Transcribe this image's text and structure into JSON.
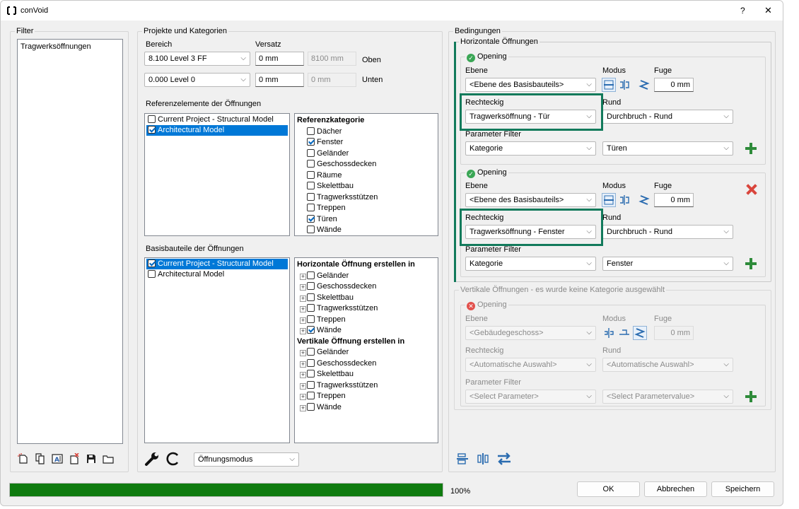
{
  "window": {
    "app_icon": "bracket-logo-icon",
    "title": "conVoid",
    "help_label": "?",
    "close_label": "✕"
  },
  "filter": {
    "label": "Filter",
    "items": [
      "Tragwerksöffnungen"
    ],
    "toolbar_icons": [
      "new-filter-icon",
      "copy-filter-icon",
      "rename-filter-icon",
      "delete-filter-icon",
      "save-filter-icon",
      "open-folder-icon"
    ]
  },
  "projects": {
    "label": "Projekte und Kategorien",
    "bereich_label": "Bereich",
    "versatz_label": "Versatz",
    "level_top": "8.100  Level 3 FF",
    "offset_top": "0 mm",
    "value_top": "8100 mm",
    "oben_label": "Oben",
    "level_bottom": "0.000  Level 0",
    "offset_bottom": "0 mm",
    "value_bottom": "0 mm",
    "unten_label": "Unten",
    "ref_label": "Referenzelemente der Öffnungen",
    "ref_models": [
      {
        "label": "Current Project - Structural Model",
        "checked": false,
        "selected": false
      },
      {
        "label": "Architectural Model",
        "checked": true,
        "selected": true
      }
    ],
    "ref_category_header": "Referenzkategorie",
    "ref_categories": [
      {
        "label": "Dächer",
        "checked": false
      },
      {
        "label": "Fenster",
        "checked": true
      },
      {
        "label": "Geländer",
        "checked": false
      },
      {
        "label": "Geschossdecken",
        "checked": false
      },
      {
        "label": "Räume",
        "checked": false
      },
      {
        "label": "Skelettbau",
        "checked": false
      },
      {
        "label": "Tragwerksstützen",
        "checked": false
      },
      {
        "label": "Treppen",
        "checked": false
      },
      {
        "label": "Türen",
        "checked": true
      },
      {
        "label": "Wände",
        "checked": false
      }
    ],
    "base_label": "Basisbauteile der Öffnungen",
    "base_models": [
      {
        "label": "Current Project - Structural Model",
        "checked": true,
        "selected": true
      },
      {
        "label": "Architectural Model",
        "checked": false,
        "selected": false
      }
    ],
    "horiz_header": "Horizontale Öffnung erstellen in",
    "horiz_items": [
      {
        "label": "Geländer",
        "checked": false
      },
      {
        "label": "Geschossdecken",
        "checked": false
      },
      {
        "label": "Skelettbau",
        "checked": false
      },
      {
        "label": "Tragwerksstützen",
        "checked": false
      },
      {
        "label": "Treppen",
        "checked": false
      },
      {
        "label": "Wände",
        "checked": true
      }
    ],
    "vert_header": "Vertikale Öffnung erstellen in",
    "vert_items": [
      {
        "label": "Geländer",
        "checked": false
      },
      {
        "label": "Geschossdecken",
        "checked": false
      },
      {
        "label": "Skelettbau",
        "checked": false
      },
      {
        "label": "Tragwerksstützen",
        "checked": false
      },
      {
        "label": "Treppen",
        "checked": false
      },
      {
        "label": "Wände",
        "checked": false
      }
    ],
    "mode_combo": "Öffnungsmodus"
  },
  "conditions": {
    "label": "Bedingungen",
    "horiz_label": "Horizontale Öffnungen",
    "opening1": {
      "title": "Opening",
      "ebene_label": "Ebene",
      "ebene_value": "<Ebene des Basisbauteils>",
      "modus_label": "Modus",
      "fuge_label": "Fuge",
      "fuge_value": "0 mm",
      "rect_label": "Rechteckig",
      "rect_value": "Tragwerksöffnung - Tür",
      "rund_label": "Rund",
      "rund_value": "Durchbruch - Rund",
      "param_label": "Parameter Filter",
      "param_key": "Kategorie",
      "param_value": "Türen"
    },
    "opening2": {
      "title": "Opening",
      "ebene_label": "Ebene",
      "ebene_value": "<Ebene des Basisbauteils>",
      "modus_label": "Modus",
      "fuge_label": "Fuge",
      "fuge_value": "0 mm",
      "rect_label": "Rechteckig",
      "rect_value": "Tragwerksöffnung - Fenster",
      "rund_label": "Rund",
      "rund_value": "Durchbruch - Rund",
      "param_label": "Parameter Filter",
      "param_key": "Kategorie",
      "param_value": "Fenster"
    },
    "vert_label": "Vertikale Öffnungen - es wurde keine Kategorie ausgewählt",
    "opening3": {
      "title": "Opening",
      "ebene_label": "Ebene",
      "ebene_value": "<Gebäudegeschoss>",
      "modus_label": "Modus",
      "fuge_label": "Fuge",
      "fuge_value": "0 mm",
      "rect_label": "Rechteckig",
      "rect_value": "<Automatische Auswahl>",
      "rund_label": "Rund",
      "rund_value": "<Automatische Auswahl>",
      "param_label": "Parameter Filter",
      "param_key": "<Select Parameter>",
      "param_value": "<Select Parametervalue>"
    }
  },
  "footer": {
    "progress_percent": 100,
    "progress_label": "100%",
    "progress_color": "#0f7b0f",
    "ok_label": "OK",
    "cancel_label": "Abbrechen",
    "save_label": "Speichern"
  },
  "colors": {
    "highlight_frame": "#127a5b",
    "selection": "#0078d7"
  }
}
